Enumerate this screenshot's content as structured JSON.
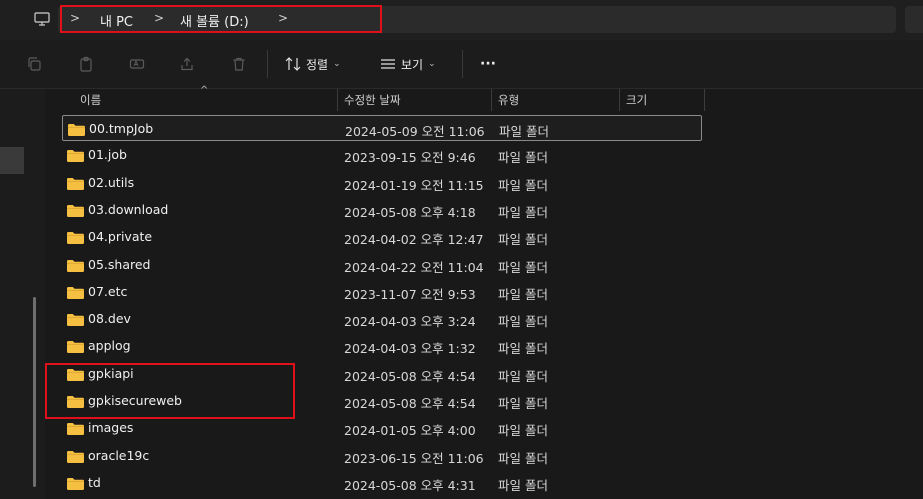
{
  "breadcrumb": [
    "내 PC",
    "새 볼륨 (D:)"
  ],
  "toolbar": {
    "sort_label": "정렬",
    "view_label": "보기",
    "more_label": "···"
  },
  "columns": {
    "name": "이름",
    "modified": "수정한 날짜",
    "type": "유형",
    "size": "크기"
  },
  "files": [
    {
      "name": "00.tmpJob",
      "modified": "2024-05-09 오전 11:06",
      "type": "파일 폴더"
    },
    {
      "name": "01.job",
      "modified": "2023-09-15 오전 9:46",
      "type": "파일 폴더"
    },
    {
      "name": "02.utils",
      "modified": "2024-01-19 오전 11:15",
      "type": "파일 폴더"
    },
    {
      "name": "03.download",
      "modified": "2024-05-08 오후 4:18",
      "type": "파일 폴더"
    },
    {
      "name": "04.private",
      "modified": "2024-04-02 오후 12:47",
      "type": "파일 폴더"
    },
    {
      "name": "05.shared",
      "modified": "2024-04-22 오전 11:04",
      "type": "파일 폴더"
    },
    {
      "name": "07.etc",
      "modified": "2023-11-07 오전 9:53",
      "type": "파일 폴더"
    },
    {
      "name": "08.dev",
      "modified": "2024-04-03 오후 3:24",
      "type": "파일 폴더"
    },
    {
      "name": "applog",
      "modified": "2024-04-03 오후 1:32",
      "type": "파일 폴더"
    },
    {
      "name": "gpkiapi",
      "modified": "2024-05-08 오후 4:54",
      "type": "파일 폴더"
    },
    {
      "name": "gpkisecureweb",
      "modified": "2024-05-08 오후 4:54",
      "type": "파일 폴더"
    },
    {
      "name": "images",
      "modified": "2024-01-05 오후 4:00",
      "type": "파일 폴더"
    },
    {
      "name": "oracle19c",
      "modified": "2023-06-15 오전 11:06",
      "type": "파일 폴더"
    },
    {
      "name": "td",
      "modified": "2024-05-08 오후 4:31",
      "type": "파일 폴더"
    }
  ],
  "colors": {
    "folder": "#f5c042",
    "highlight": "#e0101b"
  }
}
